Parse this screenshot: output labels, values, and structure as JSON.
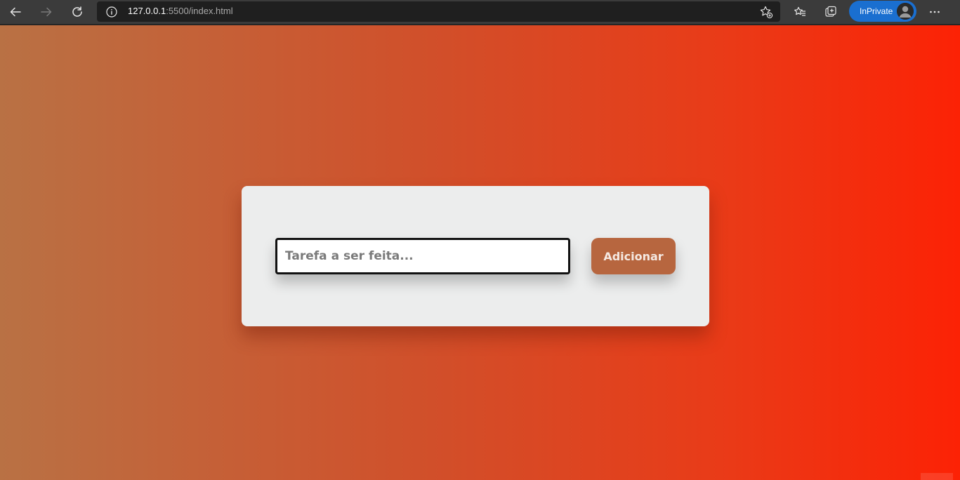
{
  "browser": {
    "url_host": "127.0.0.1",
    "url_rest": ":5500/index.html",
    "inprivate_label": "InPrivate"
  },
  "icons": {
    "back": "arrow-left-icon",
    "forward": "arrow-right-icon",
    "reload": "reload-icon",
    "site_info": "info-icon",
    "add_favorite": "star-plus-icon",
    "favorites": "favorites-icon",
    "collections": "collections-icon",
    "profile": "avatar",
    "more": "more-dots-icon"
  },
  "colors": {
    "gradient_start": "#b97144",
    "gradient_end": "#fc2205",
    "card_bg": "#eceded",
    "button_bg": "#b7663f",
    "inprivate_bg": "#1a6fd0"
  },
  "app": {
    "input_placeholder": "Tarefa a ser feita...",
    "input_value": "",
    "add_button_label": "Adicionar"
  }
}
